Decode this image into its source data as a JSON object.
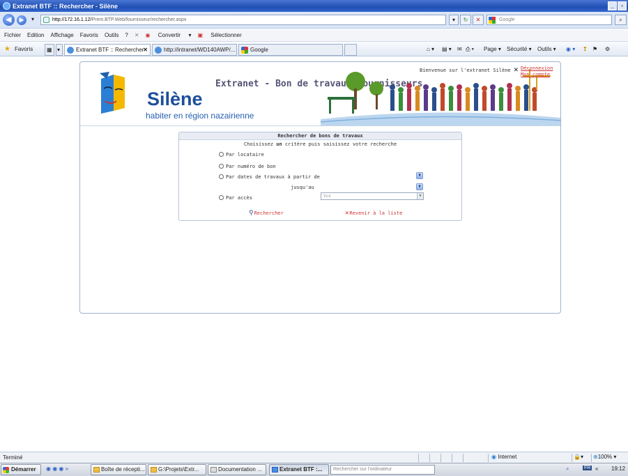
{
  "window": {
    "title": "Extranet BTF :: Rechercher - Silène"
  },
  "address": {
    "url_host": "http://172.16.1.12/",
    "url_path": "Prem.BTP.Web/fournisseur/rechercher.aspx",
    "search_placeholder": "Google"
  },
  "menu": {
    "items": [
      "Fichier",
      "Edition",
      "Affichage",
      "Favoris",
      "Outils",
      "?"
    ],
    "convert": "Convertir",
    "select": "Sélectionner"
  },
  "favorites": {
    "label": "Favoris",
    "tabs": [
      "Extranet BTF :: Rechercher",
      "http://intranet/WD140AWP/...",
      "Google"
    ],
    "commands": [
      "Page",
      "Sécurité",
      "Outils"
    ]
  },
  "site": {
    "brand": "Silène",
    "tagline": "habiter en région nazairienne",
    "title": "Extranet - Bon de travaux fournisseurs",
    "welcome": "Bienvenue sur l'extranet Silène",
    "logout": "Déconnexion",
    "account": "Mon compte"
  },
  "search": {
    "title": "Rechercher de bons de travaux",
    "subtitle_pre": "Choisissez ",
    "subtitle_bold": "un",
    "subtitle_post": " critère puis saisissez votre recherche",
    "opt_locataire": "Par locataire",
    "opt_numero": "Par numéro de bon",
    "opt_dates": "Par dates de travaux à partir de",
    "until": "jusqu'au",
    "opt_acces": "Par accès",
    "acces_value": "Vus",
    "btn_search": "Rechercher",
    "btn_back": "Revenir à la liste"
  },
  "status": {
    "left": "Terminé",
    "zone": "Internet",
    "zoom": "100%"
  },
  "taskbar": {
    "start": "Démarrer",
    "tasks": [
      "Boîte de récepti...",
      "G:\\Projets\\Extr...",
      "Documentation ...",
      "Extranet BTF :..."
    ],
    "search": "Rechercher sur l'ordinateur",
    "lang": "FR",
    "clock": "19:12"
  }
}
